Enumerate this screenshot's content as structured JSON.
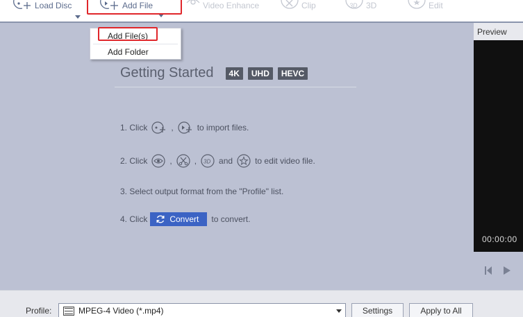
{
  "toolbar": {
    "load_disc": "Load Disc",
    "add_file": "Add File",
    "video_enhance": "Video Enhance",
    "clip": "Clip",
    "three_d": "3D",
    "edit": "Edit"
  },
  "dropdown": {
    "items": [
      "Add File(s)",
      "Add Folder"
    ]
  },
  "getting_started": {
    "title": "Getting Started",
    "badges": [
      "4K",
      "UHD",
      "HEVC"
    ],
    "step1": {
      "prefix": "1. Click",
      "comma": ",",
      "suffix": "to import files."
    },
    "step2": {
      "prefix": "2. Click",
      "comma1": ",",
      "comma2": ",",
      "and": "and",
      "suffix": "to edit video file."
    },
    "step3": {
      "text": "3. Select output format from the \"Profile\" list."
    },
    "step4": {
      "prefix": "4. Click",
      "button": "Convert",
      "suffix": "to convert."
    }
  },
  "preview": {
    "label": "Preview",
    "time": "00:00:00"
  },
  "bottom": {
    "profile_label": "Profile:",
    "profile_value": "MPEG-4 Video (*.mp4)",
    "settings": "Settings",
    "apply_all": "Apply to All"
  },
  "colors": {
    "accent": "#3b63c4",
    "highlight": "#e0262a",
    "main_bg": "#bcc1d3"
  }
}
